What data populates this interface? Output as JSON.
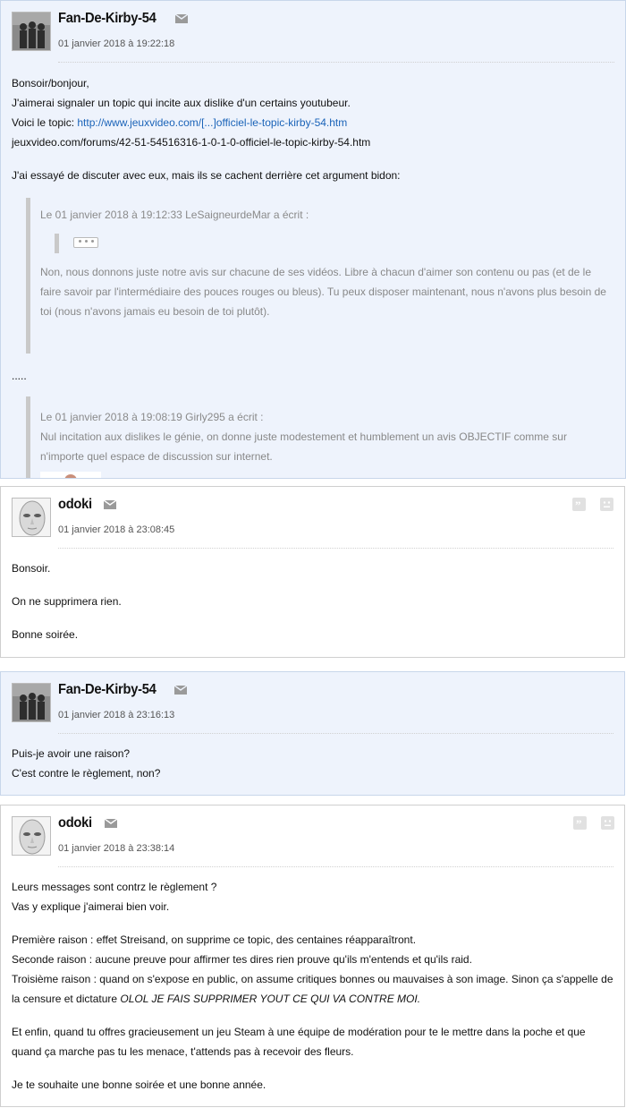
{
  "posts": [
    {
      "author": "Fan-De-Kirby-54",
      "date": "01 janvier 2018 à 19:22:18",
      "lines": [
        "Bonsoir/bonjour,",
        "J'aimerai signaler un topic qui incite aux dislike d'un certains youtubeur.",
        "Voici le topic: ",
        "http://www.jeuxvideo.com/[...]officiel-le-topic-kirby-54.htm",
        "jeuxvideo.com/forums/42-51-54516316-1-0-1-0-officiel-le-topic-kirby-54.htm",
        "J'ai essayé de discuter avec eux, mais ils se cachent derrière cet argument bidon:"
      ],
      "quote1": {
        "head": "Le 01 janvier 2018 à 19:12:33 LeSaigneurdeMar a écrit :",
        "text": "Non, nous donnons juste notre avis sur chacune de ses vidéos. Libre à chacun d'aimer son contenu ou pas (et de le faire savoir par l'intermédiaire des pouces rouges ou bleus). Tu peux disposer maintenant, nous n'avons plus besoin de toi (nous n'avons jamais eu besoin de toi plutôt)."
      },
      "dots": ".....",
      "quote2": {
        "head": "Le 01 janvier 2018 à 19:08:19 Girly295 a écrit :",
        "text": "Nul incitation aux dislikes le génie, on donne juste modestement et humblement un avis OBJECTIF comme sur n'importe quel espace de discussion sur internet."
      }
    },
    {
      "author": "odoki",
      "date": "01 janvier 2018 à 23:08:45",
      "lines": [
        "Bonsoir.",
        "On ne supprimera rien.",
        "Bonne soirée."
      ]
    },
    {
      "author": "Fan-De-Kirby-54",
      "date": "01 janvier 2018 à 23:16:13",
      "lines": [
        "Puis-je avoir une raison?",
        "C'est contre le règlement, non?"
      ]
    },
    {
      "author": "odoki",
      "date": "01 janvier 2018 à 23:38:14",
      "lines": [
        "Leurs messages sont contrz le règlement ?",
        "Vas y explique j'aimerai bien voir.",
        "Première raison : effet Streisand, on supprime ce topic, des centaines réapparaîtront.",
        "Seconde raison : aucune preuve pour affirmer tes dires rien prouve qu'ils m'entends et qu'ils raid.",
        "Troisième raison : quand on s'expose en public, on assume critiques bonnes ou mauvaises à son image. Sinon ça s'appelle de la censure et dictature ",
        "OLOL JE FAIS SUPPRIMER YOUT CE QUI VA CONTRE MOI.",
        "Et enfin, quand tu offres gracieusement un jeu Steam à une équipe de modération pour te le mettre dans la poche et que quand ça marche pas tu les menace, t'attends pas à recevoir des fleurs.",
        "Je te souhaite une bonne soirée et une bonne année."
      ]
    }
  ],
  "icons": {
    "mp": "envelope-icon",
    "quote": "quote-icon",
    "report": "sad-face-icon"
  }
}
